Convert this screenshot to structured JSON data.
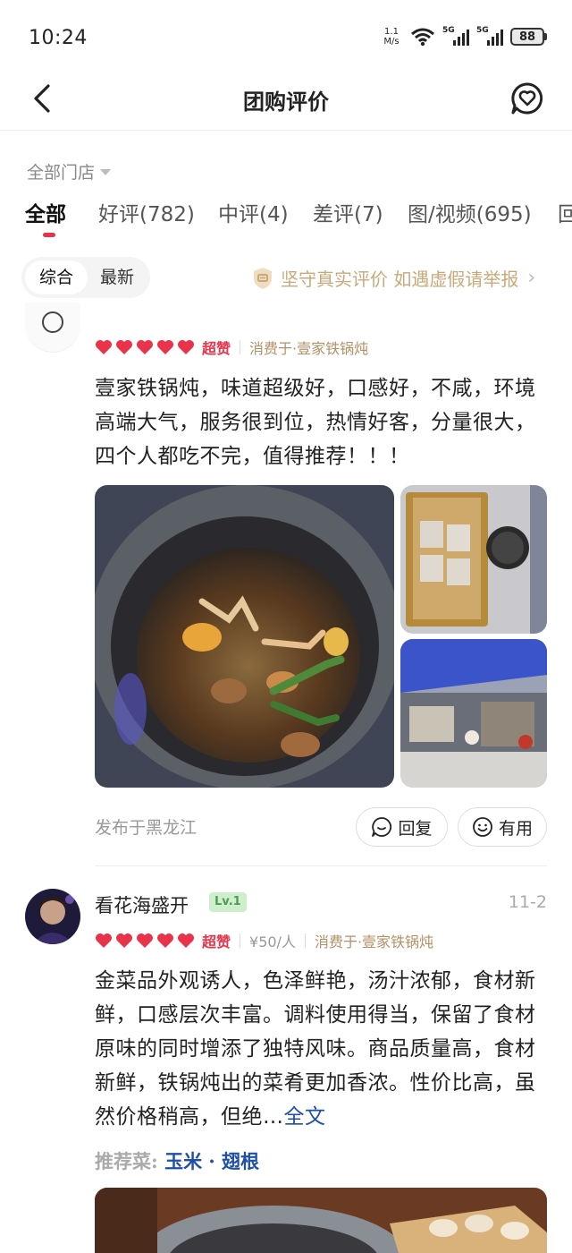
{
  "status_bar": {
    "time": "10:24",
    "net_speed_value": "1.1",
    "net_speed_unit": "M/s",
    "signal1_label": "5G",
    "signal2_label": "5G",
    "battery": "88"
  },
  "nav": {
    "title": "团购评价",
    "back_icon": "chevron-left-icon",
    "message_icon": "heart-chat-icon"
  },
  "filters": {
    "store": "全部门店",
    "tabs": [
      {
        "label": "全部"
      },
      {
        "label": "好评(782)"
      },
      {
        "label": "中评(4)"
      },
      {
        "label": "差评(7)"
      },
      {
        "label": "图/视频(695)"
      },
      {
        "label": "回"
      }
    ],
    "sort": [
      "综合",
      "最新"
    ],
    "notice": "坚守真实评价 如遇虚假请举报"
  },
  "colors": {
    "accent": "#e8334a",
    "notice": "#c8a97a",
    "link": "#1f4fa8"
  },
  "reviews": [
    {
      "hearts": 5,
      "praise": "超赞",
      "consumed_at": "消费于·壹家铁锅炖",
      "text": "壹家铁锅炖，味道超级好，口感好，不咸，环境高端大气，服务很到位，热情好客，分量很大，四个人都吃不完，值得推荐！！！",
      "posted_from": "发布于黑龙江",
      "reply_label": "回复",
      "useful_label": "有用"
    },
    {
      "username": "看花海盛开",
      "level": "Lv.1",
      "date": "11-2",
      "hearts": 5,
      "praise": "超赞",
      "price": "¥50/人",
      "consumed_at": "消费于·壹家铁锅炖",
      "text": "金菜品外观诱人，色泽鲜艳，汤汁浓郁，食材新鲜，口感层次丰富。调料使用得当，保留了食材原味的同时增添了独特风味。商品质量高，食材新鲜，铁锅炖出的菜肴更加香浓。性价比高，虽然价格稍高，但绝…",
      "more": "全文",
      "recommend_label": "推荐菜:",
      "dishes": [
        "玉米",
        "翅根"
      ]
    }
  ]
}
